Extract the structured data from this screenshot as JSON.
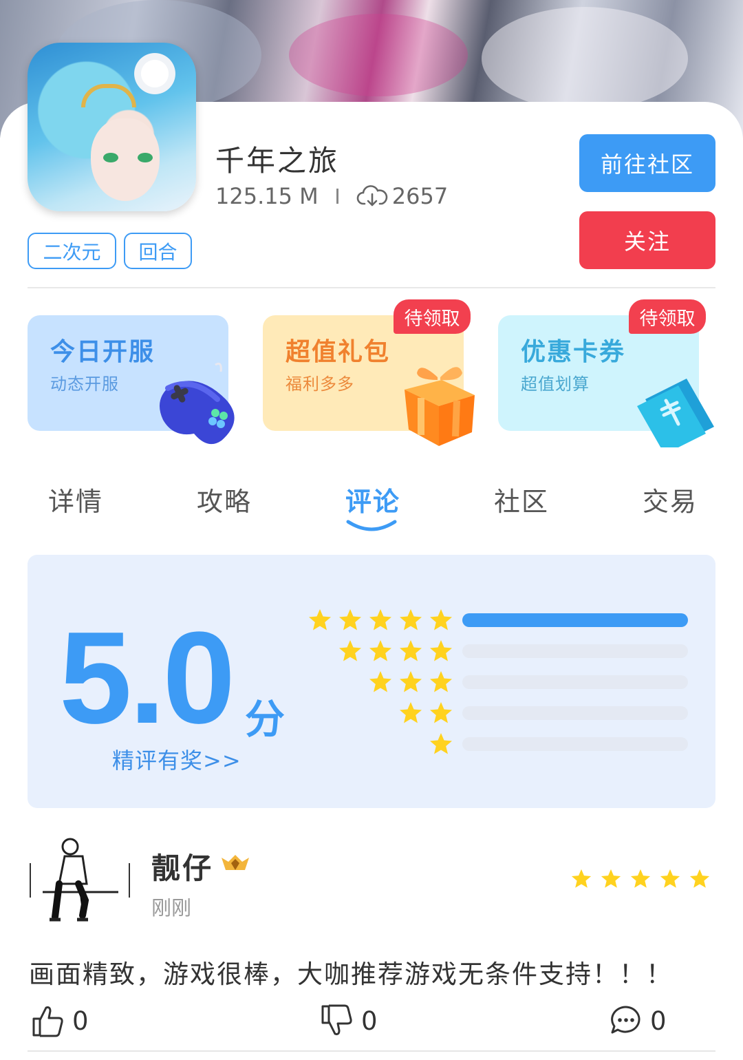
{
  "game": {
    "title": "千年之旅",
    "size": "125.15 M",
    "downloads": "2657",
    "tags": [
      "二次元",
      "回合"
    ]
  },
  "buttons": {
    "community": "前往社区",
    "follow": "关注"
  },
  "cards": [
    {
      "title": "今日开服",
      "subtitle": "动态开服",
      "icon": "gamepad-icon"
    },
    {
      "title": "超值礼包",
      "subtitle": "福利多多",
      "badge": "待领取",
      "icon": "gift-icon"
    },
    {
      "title": "优惠卡券",
      "subtitle": "超值划算",
      "badge": "待领取",
      "icon": "ticket-icon"
    }
  ],
  "tabs": [
    "详情",
    "攻略",
    "评论",
    "社区",
    "交易"
  ],
  "active_tab": "评论",
  "rating": {
    "score": "5.0",
    "unit": "分",
    "link": "精评有奖>>",
    "distribution": [
      {
        "stars": 5,
        "fraction": 1.0
      },
      {
        "stars": 4,
        "fraction": 0.0
      },
      {
        "stars": 3,
        "fraction": 0.0
      },
      {
        "stars": 2,
        "fraction": 0.0
      },
      {
        "stars": 1,
        "fraction": 0.0
      }
    ]
  },
  "review": {
    "username": "靓仔",
    "time": "刚刚",
    "stars": 5,
    "text": "画面精致，游戏很棒，大咖推荐游戏无条件支持！！！",
    "likes": "0",
    "dislikes": "0",
    "comments": "0"
  },
  "colors": {
    "primary": "#3d9bf5",
    "follow": "#f23e4e",
    "star": "#ffd21f"
  }
}
